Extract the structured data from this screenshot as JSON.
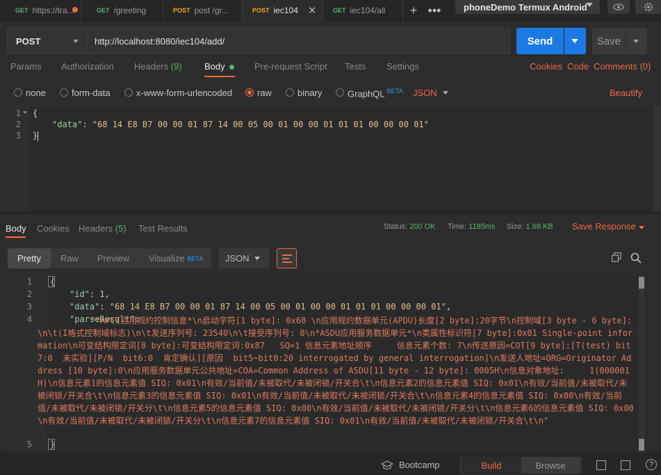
{
  "tabs": [
    {
      "method": "GET",
      "label": "https://tra...",
      "unsaved": true
    },
    {
      "method": "GET",
      "label": "/greeting"
    },
    {
      "method": "POST",
      "label": "post /gr..."
    },
    {
      "method": "POST",
      "label": "iec104",
      "active": true
    },
    {
      "method": "GET",
      "label": "iec104/all"
    }
  ],
  "environment": "phoneDemo Termux Android",
  "request": {
    "method": "POST",
    "url": "http://localhost:8080/iec104/add/",
    "send_label": "Send",
    "save_label": "Save",
    "tabs": {
      "params": "Params",
      "authorization": "Authorization",
      "headers": "Headers",
      "headers_count": "(9)",
      "body": "Body",
      "prerequest": "Pre-request Script",
      "tests": "Tests",
      "settings": "Settings"
    },
    "links": {
      "cookies": "Cookies",
      "code": "Code",
      "comments": "Comments (0)"
    },
    "body_types": {
      "none": "none",
      "form_data": "form-data",
      "urlencoded": "x-www-form-urlencoded",
      "raw": "raw",
      "binary": "binary",
      "graphql": "GraphQL",
      "beta": "BETA"
    },
    "format": "JSON",
    "beautify": "Beautify",
    "editor": {
      "ln1": "1",
      "ln2": "2",
      "ln3": "3",
      "open": "{",
      "key": "\"data\"",
      "colon": ": ",
      "value": "\"68 14 E8 B7 00 00 01 87 14 00 05 00 01 00 00 01 01 01 00 00 00 01\"",
      "close": "}"
    }
  },
  "response": {
    "tabs": {
      "body": "Body",
      "cookies": "Cookies",
      "headers": "Headers",
      "headers_count": "(5)",
      "test_results": "Test Results"
    },
    "status_label": "Status:",
    "status": "200 OK",
    "time_label": "Time:",
    "time": "1185ms",
    "size_label": "Size:",
    "size": "1.68 KB",
    "save_response": "Save Response",
    "views": {
      "pretty": "Pretty",
      "raw": "Raw",
      "preview": "Preview",
      "visualize": "Visualize",
      "beta": "BETA"
    },
    "format": "JSON",
    "editor": {
      "ln1": "1",
      "ln2": "2",
      "ln3": "3",
      "ln4": "4",
      "ln5": "5",
      "open": "{",
      "id_key": "\"id\"",
      "id_val": "1",
      "data_key": "\"data\"",
      "data_val": "\"68 14 E8 B7 00 00 01 87 14 00 05 00 01 00 00 01 01 01 00 00 00 01\"",
      "parse_key": "\"parseResult\"",
      "parse_val": "\"*APCI应用规约控制信息*\\n启动字符[1 byte]: 0x68 \\n应用规约数据单元(APDU)长度[2 byte]:20字节\\n控制域[3 byte - 6 byte]: \\n\\t(I格式控制域标志)\\n\\t发送序列号: 23540\\n\\t接受序列号: 0\\n*ASDU应用服务数据单元*\\n类属性标识符[7 byte]:0x01 Single-point information\\n可变结构限定词[8 byte]:可变结构限定词:0x87   SQ=1 信息元素地址顺序     信息元素个数: 7\\n传送原因=COT[9 byte]:[T(test) bit7:0  未实验][P/N  bit6:0  肯定确认][原因  bit5~bit0:20 interrogated by general interrogation]\\n发送人地址=ORG=Originator Address [10 byte]:0\\n应用服务数据单元公共地址=COA=Common Address of ASDU[11 byte - 12 byte]: 0005H\\n信息对象地址:     1(000001H)\\n信息元素1的信息元素值 SIQ: 0x01\\n有效/当前值/未被取代/未被闭锁/开关合\\t\\n信息元素2的信息元素值 SIQ: 0x01\\n有效/当前值/未被取代/未被闭锁/开关合\\t\\n信息元素3的信息元素值 SIQ: 0x01\\n有效/当前值/未被取代/未被闭锁/开关合\\t\\n信息元素4的信息元素值 SIQ: 0x00\\n有效/当前值/未被取代/未被闭锁/开关分\\t\\n信息元素5的信息元素值 SIQ: 0x00\\n有效/当前值/未被取代/未被闭锁/开关分\\t\\n信息元素6的信息元素值 SIQ: 0x00\\n有效/当前值/未被取代/未被闭锁/开关分\\t\\n信息元素7的信息元素值 SIQ: 0x01\\n有效/当前值/未被取代/未被闭锁/开关合\\t\\n\"",
      "close": "}"
    }
  },
  "bottom": {
    "bootcamp": "Bootcamp",
    "build": "Build",
    "browse": "Browse",
    "help": "?"
  },
  "colors": {
    "accent": "#ff6c37",
    "send": "#1c7ae4",
    "success": "#59b36f"
  }
}
